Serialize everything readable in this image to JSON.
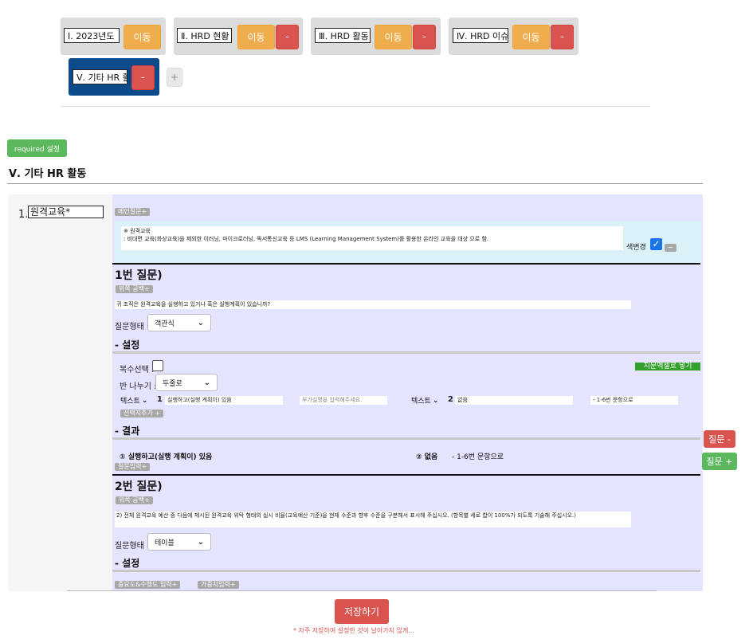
{
  "tabs": [
    {
      "label": "Ⅰ. 2023년도",
      "move_label": "이동",
      "delete_label": ""
    },
    {
      "label": "Ⅱ. HRD 현황",
      "move_label": "이동",
      "delete_label": "-"
    },
    {
      "label": "Ⅲ. HRD 활동",
      "move_label": "이동",
      "delete_label": "-"
    },
    {
      "label": "Ⅳ. HRD 이슈",
      "move_label": "이동",
      "delete_label": "-"
    },
    {
      "label": "Ⅴ. 기타 HR 활동",
      "move_label": "",
      "delete_label": "-"
    }
  ],
  "add_tab_label": "+",
  "required_button": "required 설정",
  "section_title": "Ⅴ. 기타 HR 활동",
  "question": {
    "number": "1.",
    "name": "원격교육*",
    "main_tag": "메인질문+",
    "intro_line1": "※ 원격교육",
    "intro_line2": ": 비대면 교육(화상교육)을 제외한 이러닝, 마이크로러닝, 독서통신교육 등 LMS (Learning Management System)를 활용한  온라인 교육을 대상 으로 함.",
    "bg_change_label": "색변경",
    "bg_check": "✓",
    "bg_minus": "−"
  },
  "sub1": {
    "heading": "1번 질문)",
    "blank_tag": "위쪽 공백+",
    "text": "귀 조직은 원격교육을 실행하고 있거나 혹은 실행계획이 있습니까?",
    "type_label": "질문형태 :",
    "type_value": "객관식",
    "settings_heading": "- 설정",
    "multi_label": "복수선택 :",
    "split_label": "반 나누기 :",
    "split_value": "두줄로",
    "excel_button": "지문엑셀로 넣기",
    "opt1_type": "텍스트",
    "opt1_num": "1 :",
    "opt1_value": "실행하고(실행 계획이) 있음",
    "opt1_extra_placeholder": "부가설명을 입력해주세요.",
    "opt2_type": "텍스트",
    "opt2_num": "2 :",
    "opt2_value": "없음",
    "opt2_extra": "- 1-6번 문항으로",
    "add_choice_tag": "선택지추가 +",
    "result_heading": "- 결과",
    "result1": "① 실행하고(실행 계획이) 있음",
    "result2": "② 없음",
    "result2_note": "- 1-6번 문항으로",
    "sub_question_tag": "질문입력+"
  },
  "sub2": {
    "heading": "2번 질문)",
    "blank_tag": "위쪽 공백+",
    "text": "2) 전체 원격교육 예산 중 다음에 제시된 원격교육 위탁 형태의 실시 비율(교육예산 기준)을 현재 수준과 향후 수준을 구분해서 표시해 주십시오. (항목별 세로 합이 100%가 되도록 기술해 주십시오.)",
    "type_label": "질문형태 :",
    "type_value": "테이블",
    "settings_heading": "- 설정",
    "tag_importance": "중요도&수행도 입력+",
    "tag_weight": "가중치입력+"
  },
  "question_minus": "질문 -",
  "question_plus": "질문 +",
  "save_button": "저장하기",
  "save_note": "* 자주 저장하여 설정한 것이 날아가지 않게..."
}
